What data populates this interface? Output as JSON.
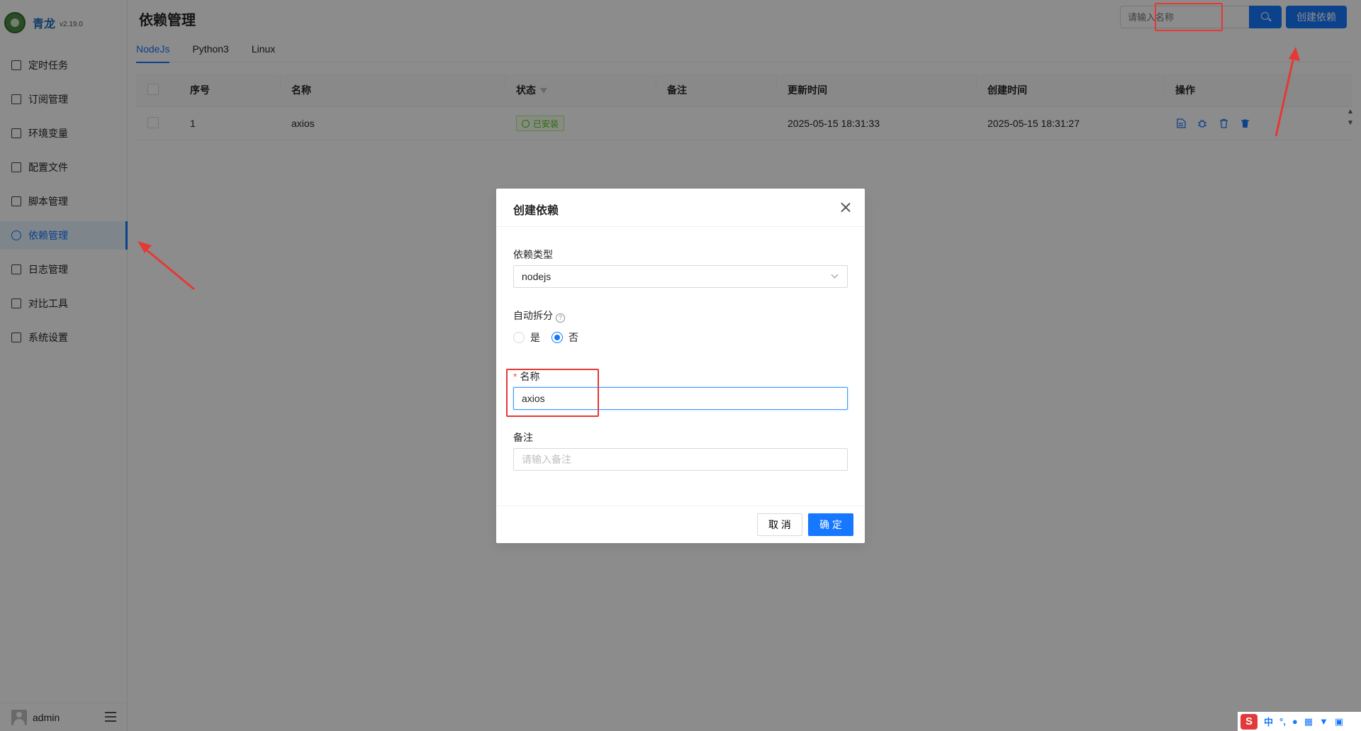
{
  "app": {
    "name": "青龙",
    "version": "v2.19.0"
  },
  "sidebar": {
    "items": [
      {
        "label": "定时任务",
        "icon": "calendar-icon"
      },
      {
        "label": "订阅管理",
        "icon": "subscription-icon"
      },
      {
        "label": "环境变量",
        "icon": "monitor-icon"
      },
      {
        "label": "配置文件",
        "icon": "sliders-icon"
      },
      {
        "label": "脚本管理",
        "icon": "script-icon"
      },
      {
        "label": "依赖管理",
        "icon": "globe-icon",
        "active": true
      },
      {
        "label": "日志管理",
        "icon": "log-icon"
      },
      {
        "label": "对比工具",
        "icon": "diff-icon"
      },
      {
        "label": "系统设置",
        "icon": "gear-icon"
      }
    ],
    "user": "admin"
  },
  "header": {
    "title": "依赖管理",
    "search_placeholder": "请输入名称",
    "create_label": "创建依赖"
  },
  "tabs": [
    "NodeJs",
    "Python3",
    "Linux"
  ],
  "table": {
    "columns": [
      "序号",
      "名称",
      "状态",
      "备注",
      "更新时间",
      "创建时间",
      "操作"
    ],
    "rows": [
      {
        "index": "1",
        "name": "axios",
        "status": "已安装",
        "remark": "",
        "updated": "2025-05-15 18:31:33",
        "created": "2025-05-15 18:31:27"
      }
    ]
  },
  "modal": {
    "title": "创建依赖",
    "type_label": "依赖类型",
    "type_value": "nodejs",
    "split_label": "自动拆分",
    "split_options": [
      "是",
      "否"
    ],
    "split_selected": "否",
    "name_label": "名称",
    "name_value": "axios",
    "remark_label": "备注",
    "remark_placeholder": "请输入备注",
    "cancel_label": "取 消",
    "ok_label": "确 定"
  },
  "ime": {
    "logo": "S",
    "mode": "中"
  },
  "colors": {
    "primary": "#1677ff",
    "success": "#52c41a",
    "annotation": "#e53935"
  }
}
